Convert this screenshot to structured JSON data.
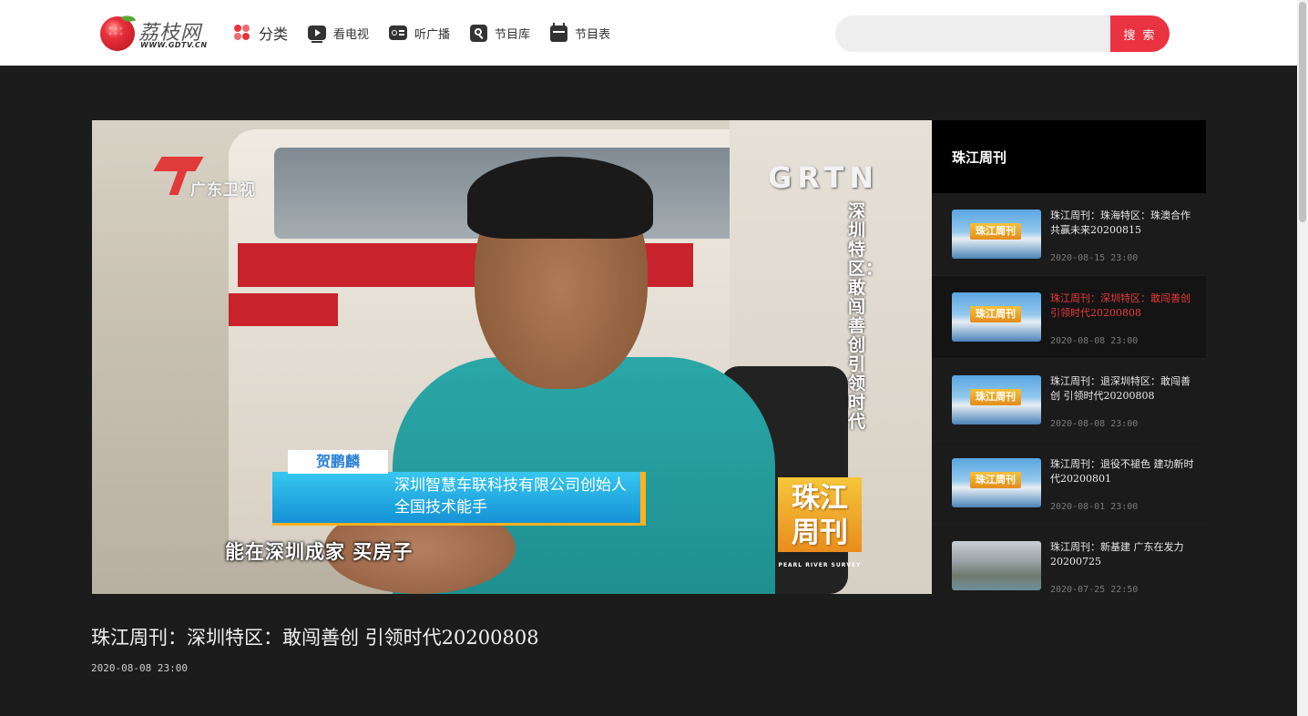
{
  "header": {
    "logo": {
      "text": "荔枝网",
      "sub": "WWW.GDTV.CN"
    },
    "nav": [
      {
        "label": "分类",
        "icon": "category-icon"
      },
      {
        "label": "看电视",
        "icon": "tv-icon"
      },
      {
        "label": "听广播",
        "icon": "radio-icon"
      },
      {
        "label": "节目库",
        "icon": "program-library-icon"
      },
      {
        "label": "节目表",
        "icon": "schedule-icon"
      }
    ],
    "search": {
      "placeholder": "",
      "value": "",
      "button": "搜 索"
    }
  },
  "player": {
    "channel_logo": "广东卫视",
    "watermark": "GRTN",
    "vertical_title": "深圳特区：敢闯善创 引领时代",
    "program_logo": "珠江周刊",
    "program_logo_en": "PEARL RIVER SURVEY",
    "lower_third": {
      "name": "贺鹏麟",
      "line1": "深圳智慧车联科技有限公司创始人",
      "line2": "全国技术能手"
    },
    "subtitle": "能在深圳成家  买房子"
  },
  "sidebar": {
    "title": "珠江周刊",
    "items": [
      {
        "title": "珠江周刊：珠海特区：珠澳合作 共赢未来20200815",
        "time": "2020-08-15 23:00",
        "thumb_badge": "珠江周刊",
        "active": false
      },
      {
        "title": "珠江周刊：深圳特区：敢闯善创 引领时代20200808",
        "time": "2020-08-08 23:00",
        "thumb_badge": "珠江周刊",
        "active": true
      },
      {
        "title": "珠江周刊：退深圳特区：敢闯善创 引领时代20200808",
        "time": "2020-08-08 23:00",
        "thumb_badge": "珠江周刊",
        "active": false
      },
      {
        "title": "珠江周刊：退役不褪色 建功新时代20200801",
        "time": "2020-08-01 23:00",
        "thumb_badge": "珠江周刊",
        "active": false
      },
      {
        "title": "珠江周刊：新基建 广东在发力20200725",
        "time": "2020-07-25 22:50",
        "thumb_badge": "",
        "active": false
      }
    ]
  },
  "video": {
    "title": "珠江周刊：深圳特区：敢闯善创 引领时代20200808",
    "date": "2020-08-08 23:00"
  },
  "colors": {
    "accent": "#ea3340",
    "active_item": "#e83a3a",
    "page_bg": "#1c1c1c"
  }
}
